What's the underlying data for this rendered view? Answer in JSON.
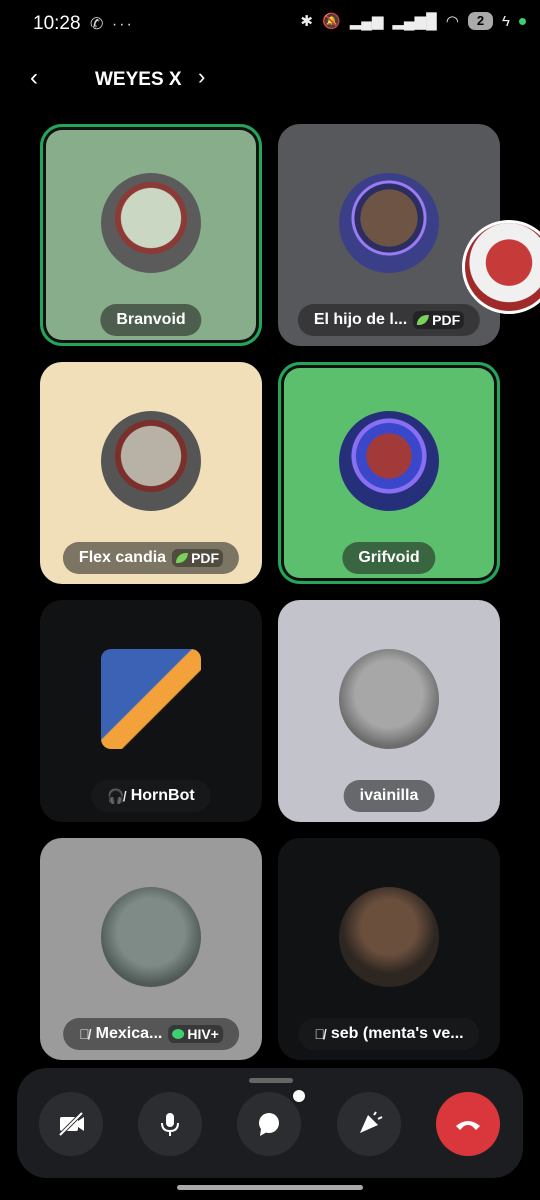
{
  "status": {
    "time": "10:28",
    "left_icons": "✆ ···",
    "battery": "2"
  },
  "header": {
    "channel": "WEYES X"
  },
  "tiles": [
    {
      "name": "Branvoid",
      "bg": "#87ad8a",
      "speaking": true,
      "badge": ""
    },
    {
      "name": "El hijo de l...",
      "bg": "#57585b",
      "speaking": false,
      "badge": "PDF"
    },
    {
      "name": "Flex candia",
      "bg": "#f0dfb8",
      "speaking": false,
      "badge": "PDF"
    },
    {
      "name": "Grifvoid",
      "bg": "#5bbf6e",
      "speaking": true,
      "badge": ""
    },
    {
      "name": "HornBot",
      "bg": "#111214",
      "speaking": false,
      "badge": ""
    },
    {
      "name": "ivainilla",
      "bg": "#c2c3cb",
      "speaking": false,
      "badge": ""
    },
    {
      "name": "Mexica...",
      "bg": "#9b9b9b",
      "speaking": false,
      "badge": "HIV+"
    },
    {
      "name": "seb (menta's ve...",
      "bg": "#111214",
      "speaking": false,
      "badge": ""
    }
  ],
  "controls": {
    "camera": "camera-off",
    "mic": "microphone",
    "chat": "chat",
    "activity": "activities",
    "end": "end-call"
  }
}
